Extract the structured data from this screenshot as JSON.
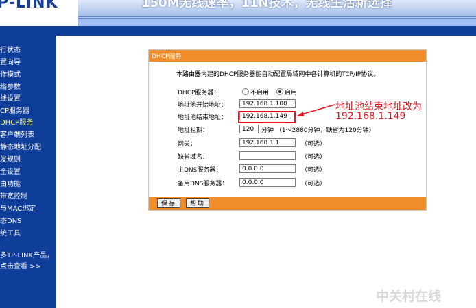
{
  "banner": {
    "logo": "P-LINK",
    "slogan": "150M无线速率，11N技术，无线生活新选择"
  },
  "sidebar": {
    "items": [
      {
        "label": "行状态"
      },
      {
        "label": "置向导"
      },
      {
        "label": "作模式"
      },
      {
        "label": "络参数"
      },
      {
        "label": "线设置"
      },
      {
        "label": "CP服务器"
      },
      {
        "label": "DHCP服务",
        "active": true
      },
      {
        "label": "客户端列表"
      },
      {
        "label": "静态地址分配"
      },
      {
        "label": "发规则"
      },
      {
        "label": "全设置"
      },
      {
        "label": "由功能"
      },
      {
        "label": "带宽控制"
      },
      {
        "label": "与MAC绑定"
      },
      {
        "label": "态DNS"
      },
      {
        "label": "统工具"
      }
    ],
    "more_text": "多TP-LINK产品，",
    "more_link": "点击查看 >>"
  },
  "panel": {
    "title": "DHCP服务",
    "description": "本路由器内建的DHCP服务器能自动配置局域网中各计算机的TCP/IP协议。",
    "dhcp_server_label": "DHCP服务器：",
    "radio_disable": "不启用",
    "radio_enable": "启用",
    "selected": "启用",
    "start_label": "地址池开始地址：",
    "start_value": "192.168.1.100",
    "end_label": "地址池结束地址：",
    "end_value": "192.168.1.149",
    "lease_label": "地址租期：",
    "lease_value": "120",
    "lease_hint": "分钟 （1～2880分钟，缺省为120分钟）",
    "gateway_label": "网关：",
    "gateway_value": "192.168.1.1",
    "domain_label": "缺省域名：",
    "domain_value": "",
    "dns1_label": "主DNS服务器：",
    "dns1_value": "0.0.0.0",
    "dns2_label": "备用DNS服务器：",
    "dns2_value": "0.0.0.0",
    "optional": "（可选）",
    "save_button": "保存",
    "help_button": "帮助"
  },
  "annotation": {
    "line1": "地址池结束地址改为",
    "line2": "192.168.1.149",
    "color": "#e0141e"
  },
  "watermark": "中关村在线",
  "colors": {
    "brand_blue": "#0f3d9a",
    "panel_orange": "#ee8d2a"
  }
}
